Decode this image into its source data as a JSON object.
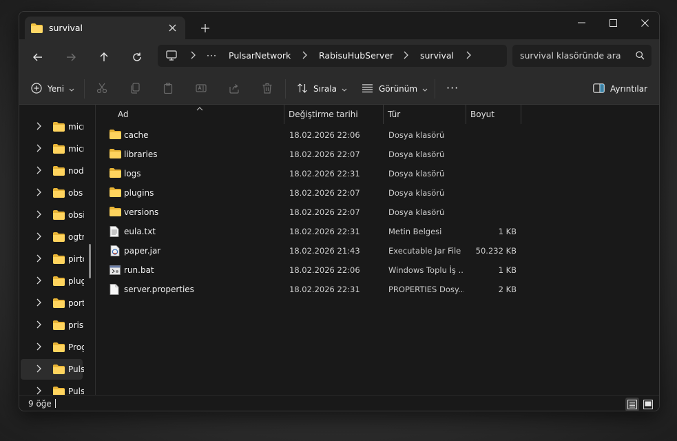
{
  "window": {
    "tab_title": "survival",
    "new_tab_symbol": "+"
  },
  "nav": {
    "breadcrumbs": [
      "PulsarNetwork",
      "RabisuHubServer",
      "survival"
    ],
    "more_symbol": "···",
    "search_placeholder": "survival klasöründe ara"
  },
  "commands": {
    "new_label": "Yeni",
    "sort_label": "Sırala",
    "view_label": "Görünüm",
    "more_symbol": "···",
    "details_label": "Ayrıntılar"
  },
  "sidebar": {
    "items": [
      {
        "label": "micro"
      },
      {
        "label": "micro"
      },
      {
        "label": "node"
      },
      {
        "label": "obs"
      },
      {
        "label": "obsidian"
      },
      {
        "label": "ogtr"
      },
      {
        "label": "pirto"
      },
      {
        "label": "plug"
      },
      {
        "label": "port"
      },
      {
        "label": "prism"
      },
      {
        "label": "Prog"
      },
      {
        "label": "Puls"
      },
      {
        "label": "Puls"
      }
    ],
    "selected_index": 11
  },
  "columns": {
    "name": "Ad",
    "modified": "Değiştirme tarihi",
    "type": "Tür",
    "size": "Boyut"
  },
  "files": [
    {
      "name": "cache",
      "modified": "18.02.2026 22:06",
      "type": "Dosya klasörü",
      "size": "",
      "icon": "folder-icon"
    },
    {
      "name": "libraries",
      "modified": "18.02.2026 22:07",
      "type": "Dosya klasörü",
      "size": "",
      "icon": "folder-icon"
    },
    {
      "name": "logs",
      "modified": "18.02.2026 22:31",
      "type": "Dosya klasörü",
      "size": "",
      "icon": "folder-icon"
    },
    {
      "name": "plugins",
      "modified": "18.02.2026 22:07",
      "type": "Dosya klasörü",
      "size": "",
      "icon": "folder-icon"
    },
    {
      "name": "versions",
      "modified": "18.02.2026 22:07",
      "type": "Dosya klasörü",
      "size": "",
      "icon": "folder-icon"
    },
    {
      "name": "eula.txt",
      "modified": "18.02.2026 22:31",
      "type": "Metin Belgesi",
      "size": "1 KB",
      "icon": "text-file-icon"
    },
    {
      "name": "paper.jar",
      "modified": "18.02.2026 21:43",
      "type": "Executable Jar File",
      "size": "50.232 KB",
      "icon": "jar-file-icon"
    },
    {
      "name": "run.bat",
      "modified": "18.02.2026 22:06",
      "type": "Windows Toplu İş ...",
      "size": "1 KB",
      "icon": "bat-file-icon"
    },
    {
      "name": "server.properties",
      "modified": "18.02.2026 22:31",
      "type": "PROPERTIES Dosy...",
      "size": "2 KB",
      "icon": "blank-file-icon"
    }
  ],
  "status": {
    "item_count": "9 öğe"
  },
  "colors": {
    "folder": "#f4c542",
    "window_bg": "#202020",
    "list_bg": "#191919"
  }
}
